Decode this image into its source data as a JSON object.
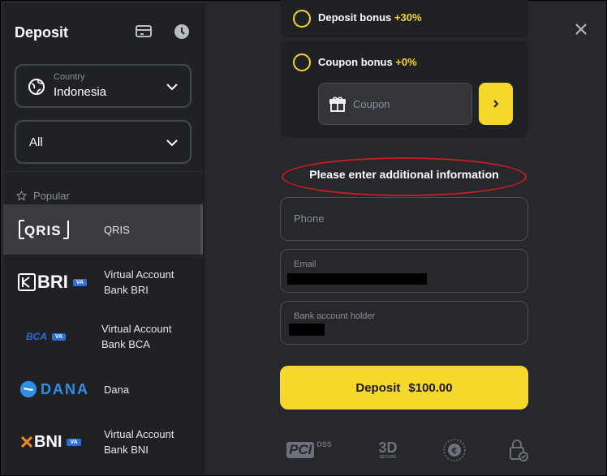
{
  "sidebar": {
    "title": "Deposit",
    "country": {
      "small_label": "Country",
      "value": "Indonesia"
    },
    "filter": {
      "value": "All"
    },
    "section": "Popular",
    "methods": [
      {
        "logo": "QRIS",
        "label": "QRIS"
      },
      {
        "logo": "BRI",
        "badge": "VA",
        "label_line1": "Virtual Account",
        "label_line2": "Bank BRI"
      },
      {
        "logo": "BCA",
        "badge": "VA",
        "label_line1": "Virtual Account",
        "label_line2": "Bank BCA"
      },
      {
        "logo": "DANA",
        "label": "Dana"
      },
      {
        "logo": "BNI",
        "badge": "VA",
        "label_line1": "Virtual Account",
        "label_line2": "Bank BNI"
      }
    ]
  },
  "bonuses": {
    "deposit_label": "Deposit bonus",
    "deposit_pct": "+30%",
    "coupon_label": "Coupon bonus",
    "coupon_pct": "+0%",
    "coupon_placeholder": "Coupon"
  },
  "form": {
    "title": "Please enter additional information",
    "phone_placeholder": "Phone",
    "email_label": "Email",
    "holder_label": "Bank account holder"
  },
  "deposit_button": {
    "label": "Deposit",
    "amount": "$100.00"
  },
  "trust_badges": {
    "pci": "PCI",
    "dss": "DSS",
    "secure3d": "3D",
    "secure3d_sub": "SECURE"
  },
  "colors": {
    "accent": "#f6d72c",
    "panel": "#1f2125",
    "bg": "#26282d",
    "highlight": "#c81e1e"
  }
}
